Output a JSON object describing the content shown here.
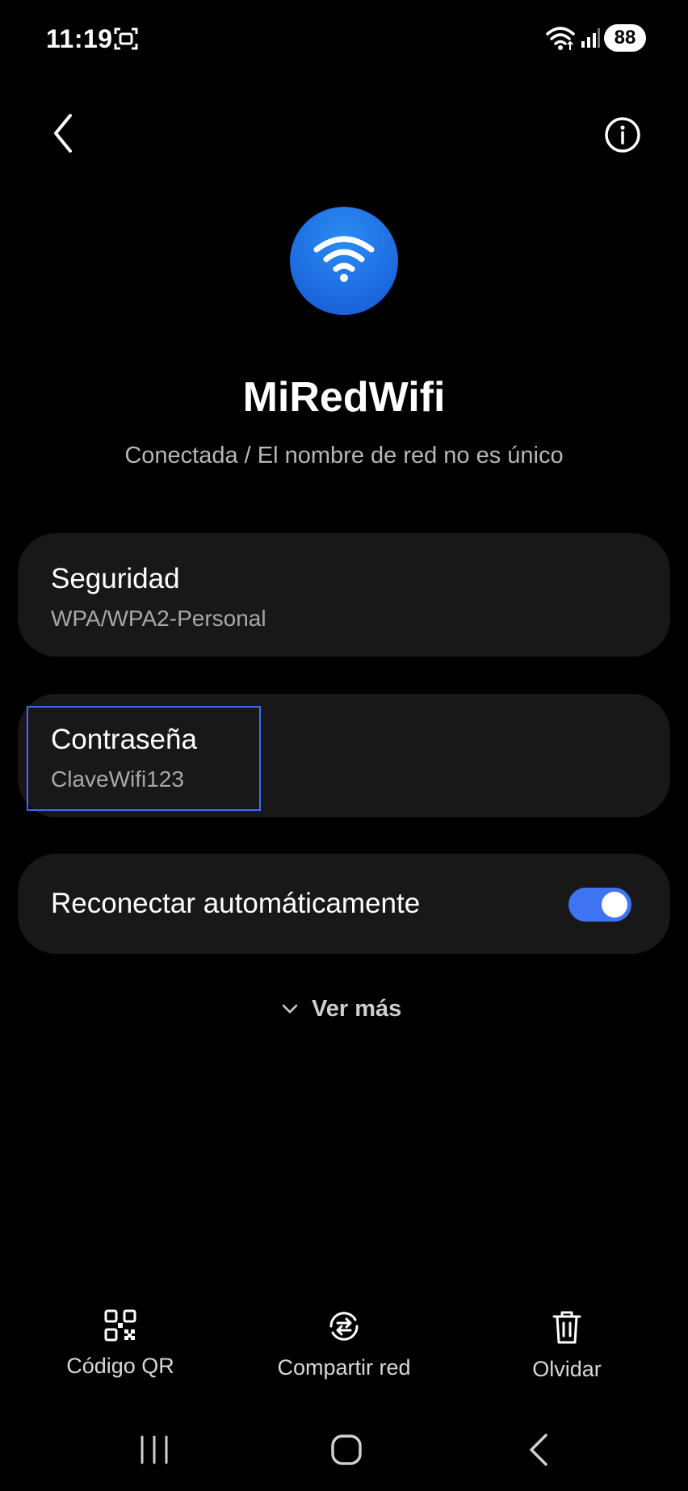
{
  "status_bar": {
    "time": "11:19",
    "battery": "88",
    "icons": [
      "screenshot-icon",
      "wifi-icon",
      "signal-icon"
    ]
  },
  "header": {
    "back_icon": "chevron-left-icon",
    "info_icon": "info-icon"
  },
  "network": {
    "icon": "wifi-icon",
    "name": "MiRedWifi",
    "status": "Conectada / El nombre de red no es único"
  },
  "security": {
    "title": "Seguridad",
    "value": "WPA/WPA2-Personal"
  },
  "password": {
    "title": "Contraseña",
    "value": "ClaveWifi123"
  },
  "reconnect": {
    "title": "Reconectar automáticamente",
    "enabled": true
  },
  "see_more": {
    "label": "Ver más",
    "icon": "chevron-down-icon"
  },
  "actions": [
    {
      "label": "Código QR",
      "icon": "qr-code-icon"
    },
    {
      "label": "Compartir red",
      "icon": "share-network-icon"
    },
    {
      "label": "Olvidar",
      "icon": "trash-icon"
    }
  ],
  "nav": {
    "recent_icon": "recent-apps-icon",
    "home_icon": "home-icon",
    "back_icon": "back-icon"
  },
  "colors": {
    "background": "#000000",
    "card": "#181818",
    "accent": "#3e73f2",
    "icon_blue": "#1f6fe3",
    "secondary_text": "#a8a8a8"
  }
}
